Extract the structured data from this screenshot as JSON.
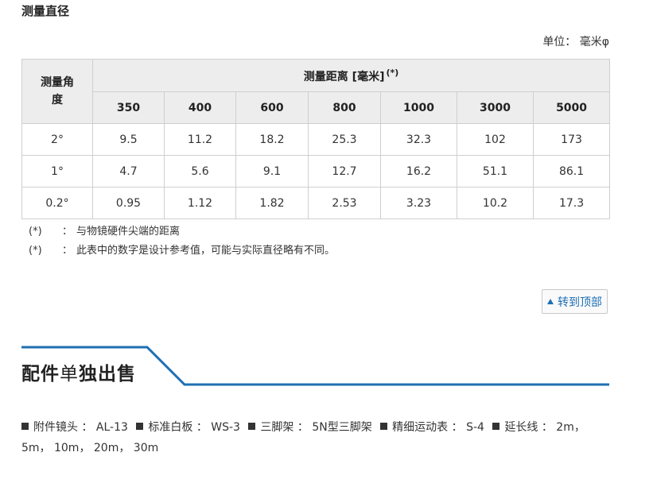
{
  "section_title": "测量直径",
  "unit_label": "单位： 毫米φ",
  "table": {
    "corner_header": [
      "测量角",
      "度"
    ],
    "distance_header": "测量距离 [毫米]",
    "distance_header_note": "(*)",
    "distances": [
      "350",
      "400",
      "600",
      "800",
      "1000",
      "3000",
      "5000"
    ],
    "rows": [
      {
        "angle": "2°",
        "values": [
          "9.5",
          "11.2",
          "18.2",
          "25.3",
          "32.3",
          "102",
          "173"
        ]
      },
      {
        "angle": "1°",
        "values": [
          "4.7",
          "5.6",
          "9.1",
          "12.7",
          "16.2",
          "51.1",
          "86.1"
        ]
      },
      {
        "angle": "0.2°",
        "values": [
          "0.95",
          "1.12",
          "1.82",
          "2.53",
          "3.23",
          "10.2",
          "17.3"
        ]
      }
    ]
  },
  "notes": [
    {
      "mark": "(*)",
      "colon": "：",
      "text": "与物镜硬件尖端的距离"
    },
    {
      "mark": "(*)",
      "colon": "：",
      "text": "此表中的数字是设计参考值，可能与实际直径略有不同。"
    }
  ],
  "to_top_label": "转到顶部",
  "accessories": {
    "title_bold_1": "配件",
    "title_light": "单",
    "title_bold_2": "独出售",
    "items": [
      {
        "name": "附件镜头",
        "value": "AL-13"
      },
      {
        "name": "标准白板",
        "value": "WS-3"
      },
      {
        "name": "三脚架",
        "value": "5N型三脚架"
      },
      {
        "name": "精细运动表",
        "value": "S-4"
      },
      {
        "name": "延长线",
        "value": "2m， 5m， 10m， 20m， 30m"
      }
    ],
    "separator": "："
  },
  "colors": {
    "accent_blue": "#1f6fb2",
    "header_bg": "#ededed",
    "border": "#cfcfcf"
  }
}
